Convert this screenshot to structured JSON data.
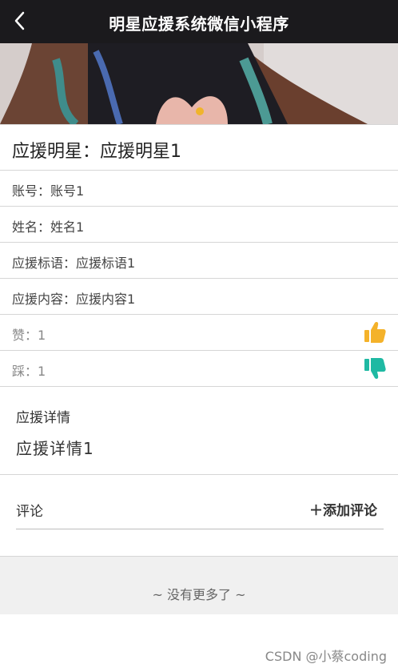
{
  "header": {
    "title": "明星应援系统微信小程序"
  },
  "detail": {
    "star_label": "应援明星：",
    "star_value": "应援明星1",
    "account_label": "账号：",
    "account_value": "账号1",
    "name_label": "姓名：",
    "name_value": "姓名1",
    "slogan_label": "应援标语：",
    "slogan_value": "应援标语1",
    "content_label": "应援内容：",
    "content_value": "应援内容1",
    "likes_label": "赞：",
    "likes_value": "1",
    "dislikes_label": "踩：",
    "dislikes_value": "1",
    "details_title": "应援详情",
    "details_text": "应援详情1"
  },
  "comments": {
    "title": "评论",
    "add_label": "＋添加评论"
  },
  "footer": {
    "no_more": "~ 没有更多了 ~",
    "watermark": "CSDN @小蔡coding"
  },
  "colors": {
    "header_bg": "#1b1a1d",
    "accent_dot": "#f0b42c",
    "like_icon": "#f4b22a",
    "dislike_icon": "#1fb9a3"
  }
}
